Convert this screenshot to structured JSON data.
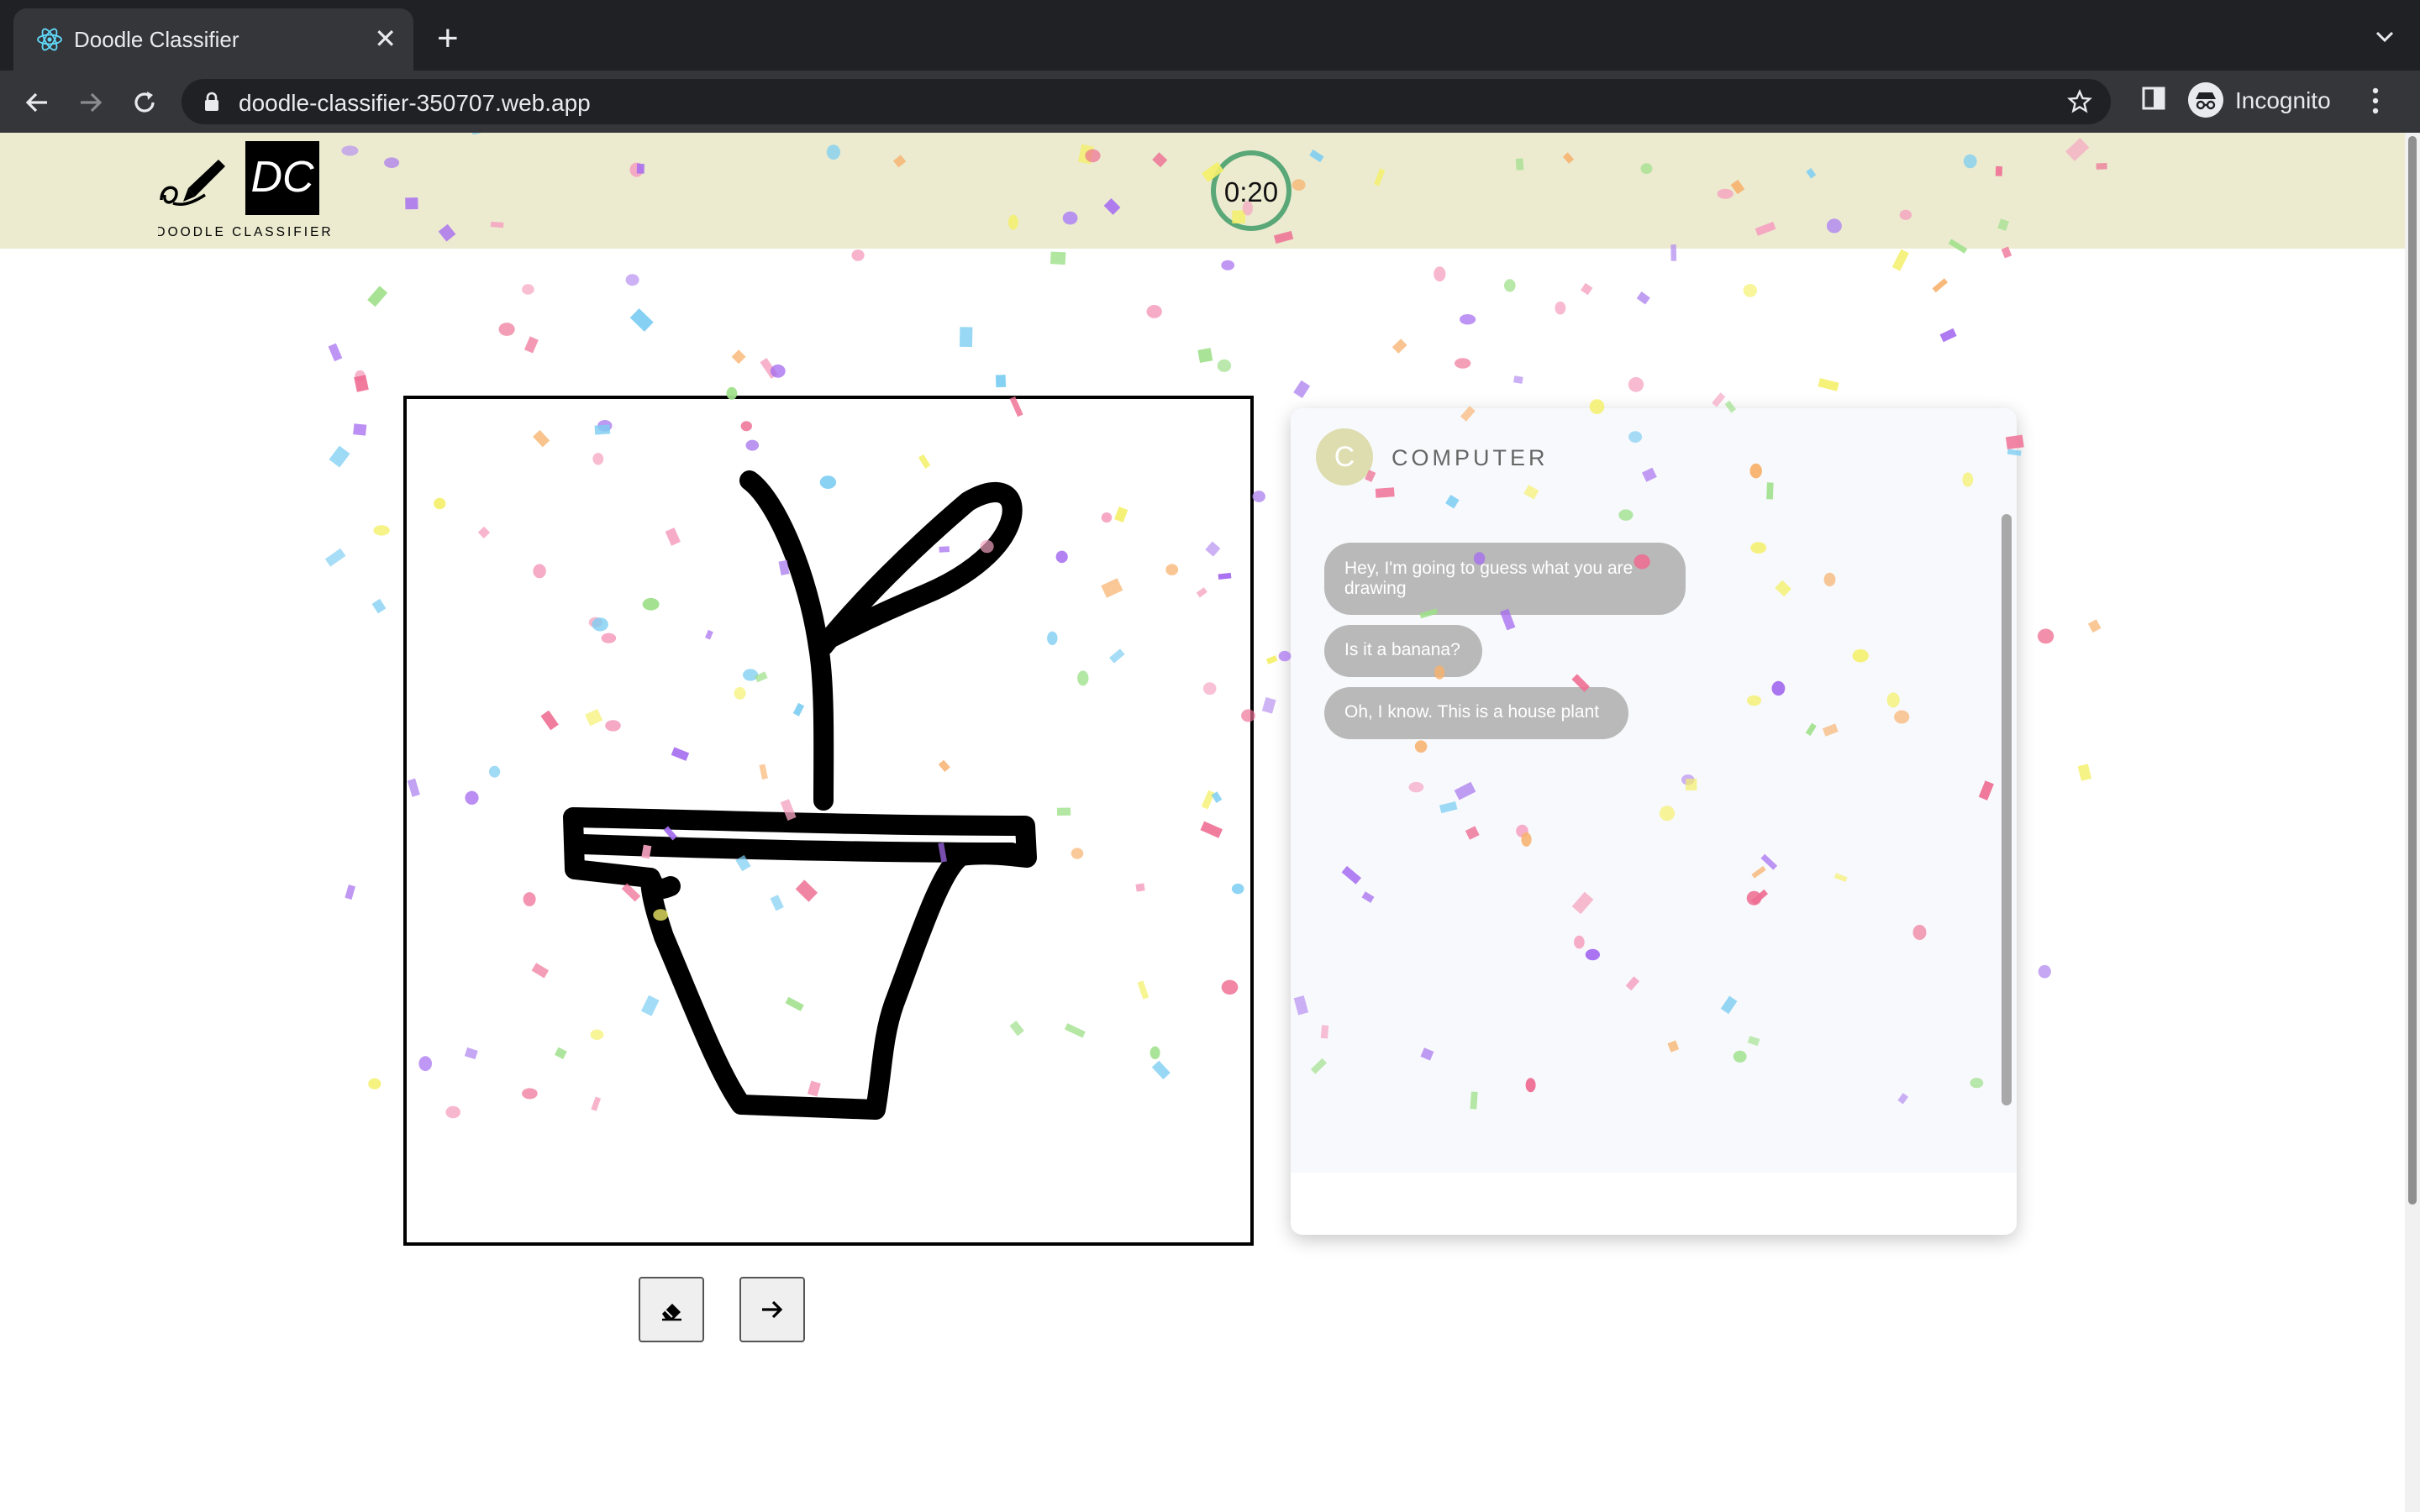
{
  "browser": {
    "tab_title": "Doodle Classifier",
    "url": "doodle-classifier-350707.web.app",
    "profile_label": "Incognito"
  },
  "app": {
    "logo_initials": "DC",
    "logo_caption": "DOODLE CLASSIFIER",
    "timer": "0:20",
    "timer_progress": 1.0,
    "theme": {
      "header_bg": "#ecebd0",
      "timer_ring": "#5aa877",
      "bubble_bg": "#b9b9b9"
    }
  },
  "chat": {
    "avatar_letter": "C",
    "name": "COMPUTER",
    "messages": [
      "Hey, I'm going to guess what you are drawing",
      "Is it a banana?",
      "Oh, I know. This is a house plant"
    ]
  },
  "controls": {
    "clear_icon": "eraser-icon",
    "next_icon": "arrow-right-icon"
  }
}
